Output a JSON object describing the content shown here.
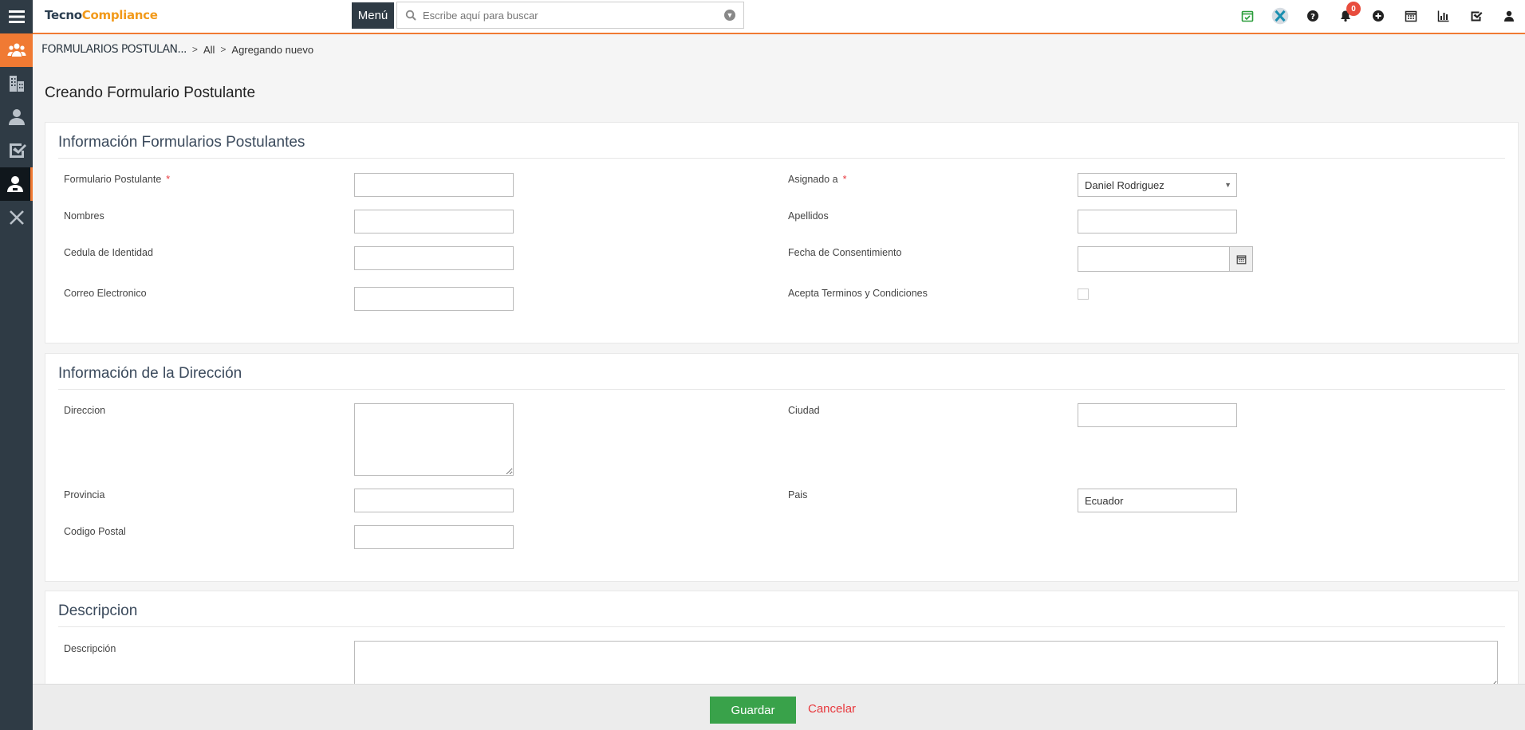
{
  "brand": {
    "part1": "Tecno",
    "part2": "Compliance"
  },
  "topbar": {
    "menu_label": "Menú",
    "search_placeholder": "Escribe aquí para buscar",
    "notification_count": "0"
  },
  "sidebar": {
    "items": [
      "hamburger-icon",
      "users-group-icon",
      "building-icon",
      "user-icon",
      "checkbox-icon",
      "user-badge-icon",
      "close-icon"
    ]
  },
  "breadcrumb": {
    "module": "FORMULARIOS POSTULAN...",
    "all": "All",
    "current": "Agregando nuevo"
  },
  "page_title": "Creando Formulario Postulante",
  "panel1": {
    "title": "Información Formularios Postulantes",
    "formulario_label": "Formulario Postulante",
    "nombres_label": "Nombres",
    "cedula_label": "Cedula de Identidad",
    "correo_label": "Correo Electronico",
    "asignado_label": "Asignado a",
    "asignado_value": "Daniel Rodriguez",
    "apellidos_label": "Apellidos",
    "fecha_label": "Fecha de Consentimiento",
    "acepta_label": "Acepta Terminos y Condiciones",
    "required_mark": "*"
  },
  "panel2": {
    "title": "Información de la Dirección",
    "direccion_label": "Direccion",
    "provincia_label": "Provincia",
    "codigo_label": "Codigo Postal",
    "ciudad_label": "Ciudad",
    "pais_label": "Pais",
    "pais_value": "Ecuador"
  },
  "panel3": {
    "title": "Descripcion",
    "descripcion_label": "Descripción"
  },
  "footer": {
    "save_label": "Guardar",
    "cancel_label": "Cancelar"
  },
  "colors": {
    "accent": "#f07a33",
    "sidebar": "#2f3b45",
    "save": "#39a24a",
    "danger": "#e8383d"
  }
}
